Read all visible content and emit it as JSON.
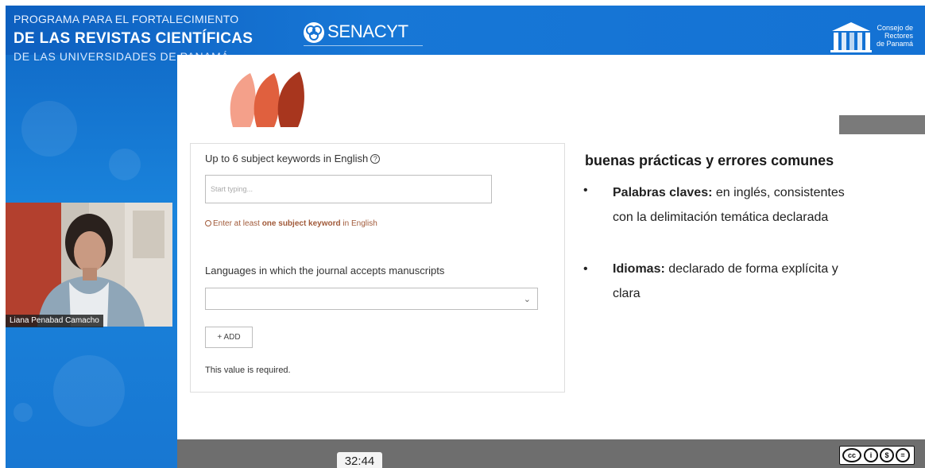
{
  "banner": {
    "program_line1": "PROGRAMA PARA EL FORTALECIMIENTO",
    "program_line2": "DE LAS REVISTAS CIENTÍFICAS",
    "program_line3": "DE LAS UNIVERSIDADES DE PANAMÁ",
    "senacyt_logo_text": "SENACYT",
    "consejo_logo_text": "Consejo de Rectores de Panamá"
  },
  "participant": {
    "name": "Liana Penabad Camacho"
  },
  "form": {
    "keywords_label": "Up to 6 subject keywords in English",
    "keywords_placeholder": "Start typing...",
    "keywords_error_prefix": "Enter at least ",
    "keywords_error_bold": "one subject keyword",
    "keywords_error_suffix": " in English",
    "languages_label": "Languages in which the journal accepts manuscripts",
    "add_button": "+ ADD",
    "required_note": "This value is required."
  },
  "practices": {
    "title": "buenas prácticas y errores comunes",
    "items": [
      {
        "term": "Palabras claves:",
        "line1": " en inglés, consistentes",
        "line2": "con la delimitación temática declarada"
      },
      {
        "term": "Idiomas:",
        "line1": " declarado de forma explícita y",
        "line2": "clara"
      }
    ]
  },
  "player": {
    "timestamp": "32:44"
  },
  "colors": {
    "banner_blue": "#1472d4",
    "error_text": "#a15a3a",
    "bottom_bar": "#6e6e6e"
  },
  "icons": [
    "help-circle-icon",
    "error-circle-icon",
    "chevron-down-icon",
    "creative-commons-icon"
  ]
}
